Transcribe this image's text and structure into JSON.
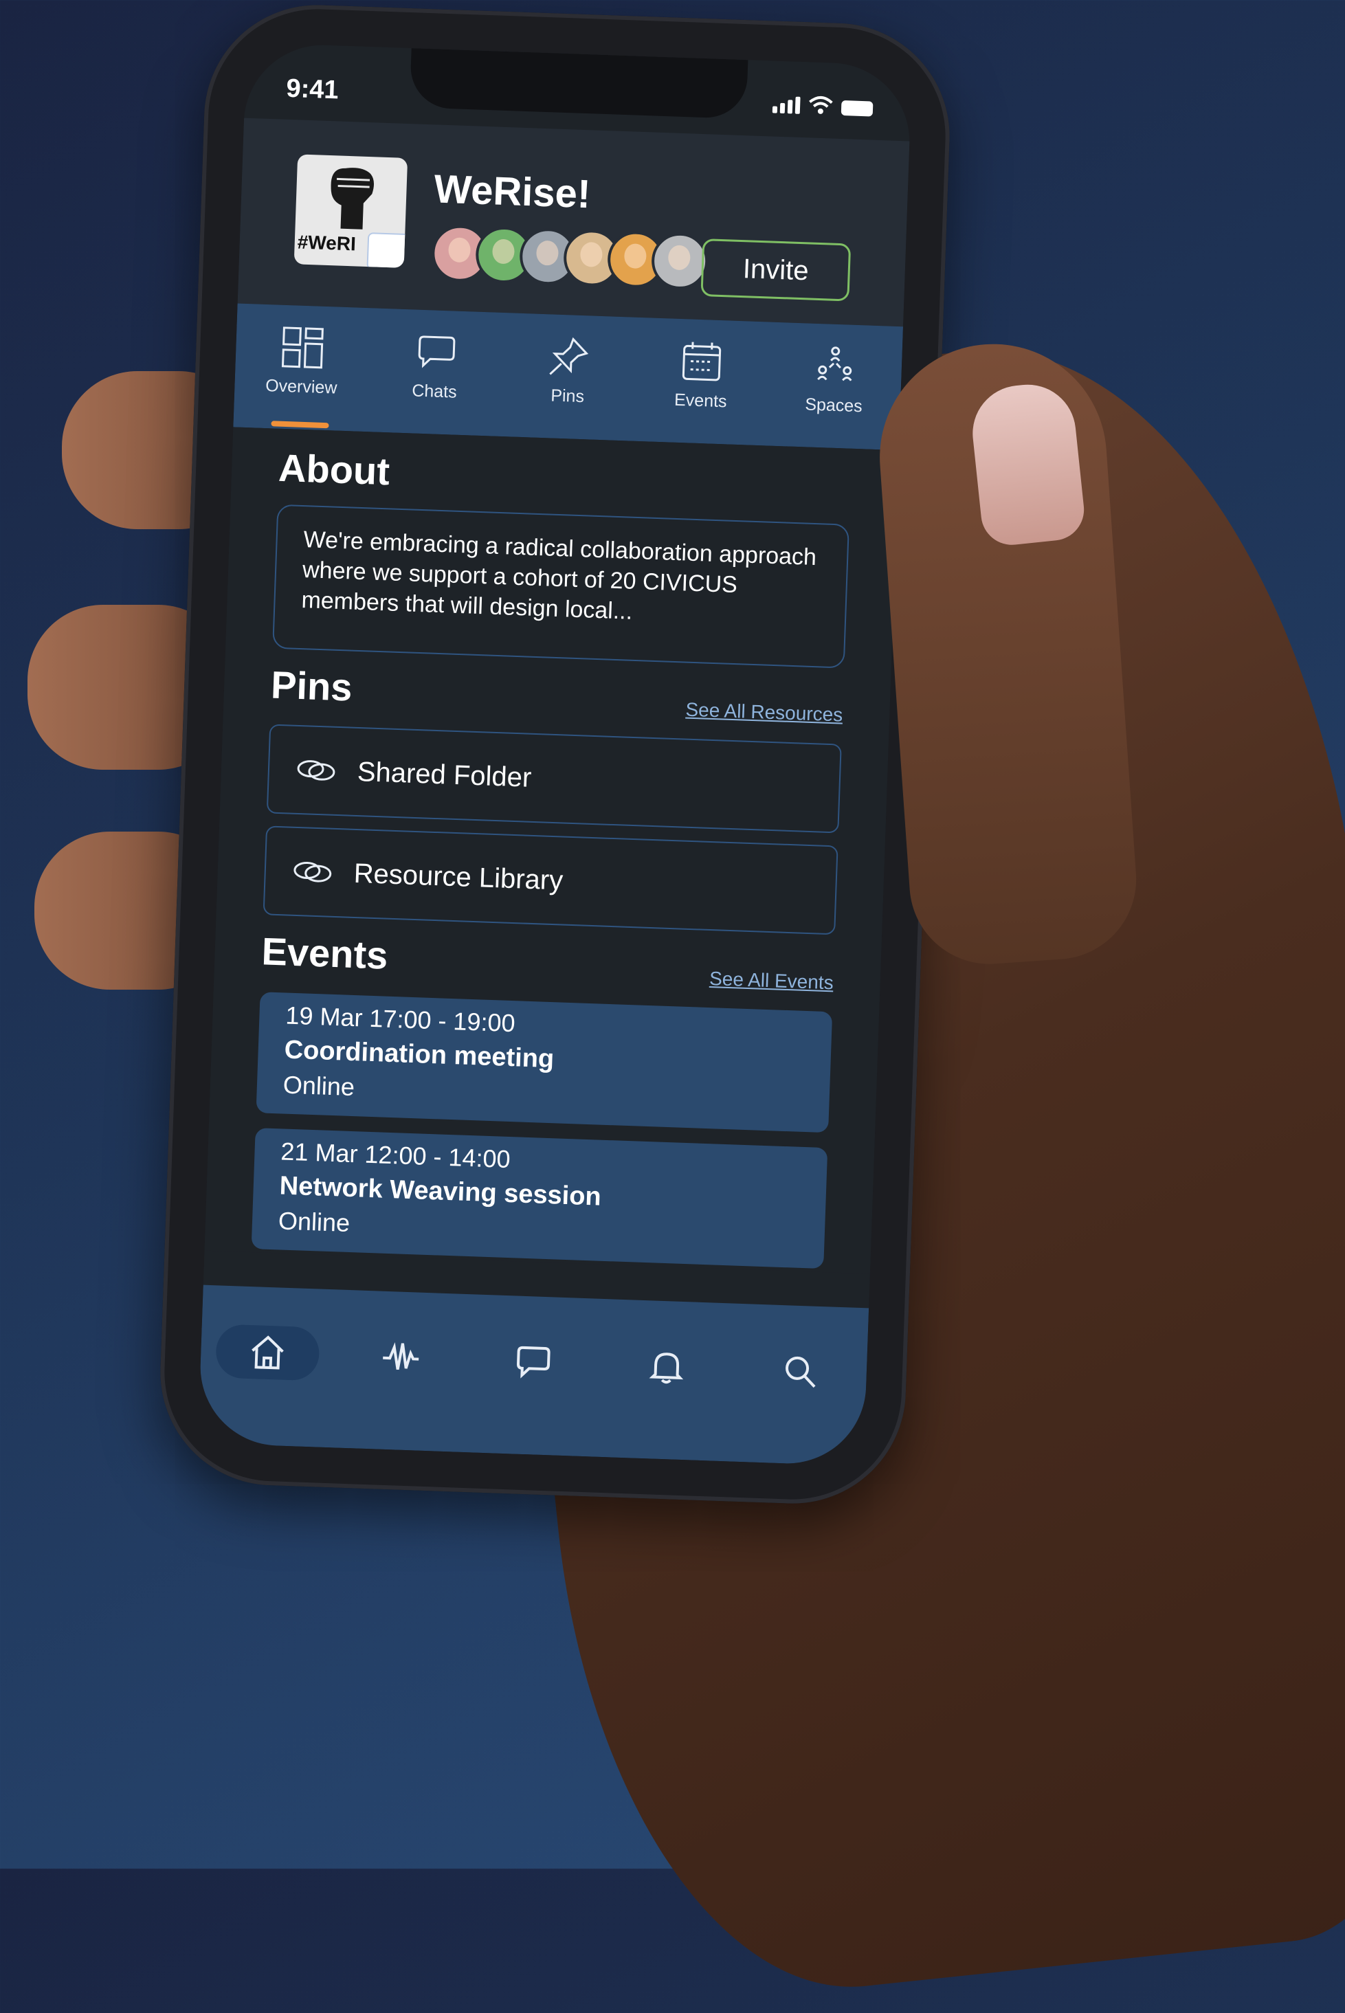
{
  "status_bar": {
    "time": "9:41"
  },
  "group": {
    "name": "WeRise!",
    "logo_text": "#WeRI",
    "avatar_colors": [
      "#d9a0a0",
      "#6fb36a",
      "#9aa3ad",
      "#d8b98f",
      "#e3a24c",
      "#b8babd"
    ],
    "invite_label": "Invite"
  },
  "tabs": [
    {
      "label": "Overview",
      "icon": "overview-icon",
      "active": true
    },
    {
      "label": "Chats",
      "icon": "chat-icon"
    },
    {
      "label": "Pins",
      "icon": "pin-icon"
    },
    {
      "label": "Events",
      "icon": "calendar-icon"
    },
    {
      "label": "Spaces",
      "icon": "spaces-icon"
    }
  ],
  "about": {
    "title": "About",
    "text": "We're embracing a radical collaboration approach where we support a cohort of 20 CIVICUS members that will design local..."
  },
  "pins": {
    "title": "Pins",
    "see_all": "See All Resources",
    "items": [
      {
        "label": "Shared Folder",
        "icon": "link-icon"
      },
      {
        "label": "Resource Library",
        "icon": "link-icon"
      }
    ]
  },
  "events": {
    "title": "Events",
    "see_all": "See All Events",
    "items": [
      {
        "time": "19 Mar 17:00 - 19:00",
        "title": "Coordination meeting",
        "place": "Online"
      },
      {
        "time": "21 Mar 12:00 - 14:00",
        "title": "Network Weaving session",
        "place": "Online"
      }
    ]
  },
  "bottom_nav": [
    {
      "icon": "home-icon",
      "active": true
    },
    {
      "icon": "activity-icon"
    },
    {
      "icon": "chat-icon"
    },
    {
      "icon": "bell-icon"
    },
    {
      "icon": "search-icon"
    }
  ],
  "colors": {
    "background": "#1f3558",
    "accent": "#2b4a6e",
    "tab_indicator": "#f0913a",
    "invite_border": "#7fbf64"
  }
}
